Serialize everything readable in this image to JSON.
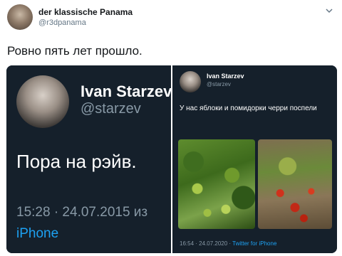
{
  "tweet": {
    "display_name": "der klassische Panama",
    "handle": "@r3dpanama",
    "text": "Ровно пять лет прошло."
  },
  "left_screenshot": {
    "name": "Ivan Starzev",
    "handle": "@starzev",
    "text": "Пора на рэйв.",
    "meta": "15:28 · 24.07.2015 из",
    "source": "iPhone"
  },
  "right_screenshot": {
    "name": "Ivan Starzev",
    "handle": "@starzev",
    "text": "У нас яблоки и помидорки черри поспели",
    "meta": "16:54 · 24.07.2020 · ",
    "source": "Twitter for iPhone"
  },
  "icons": {
    "menu": "chevron-down-icon"
  },
  "colors": {
    "dark_bg": "#15202b",
    "link_blue": "#1da1f2",
    "muted_gray": "#8899a6"
  }
}
